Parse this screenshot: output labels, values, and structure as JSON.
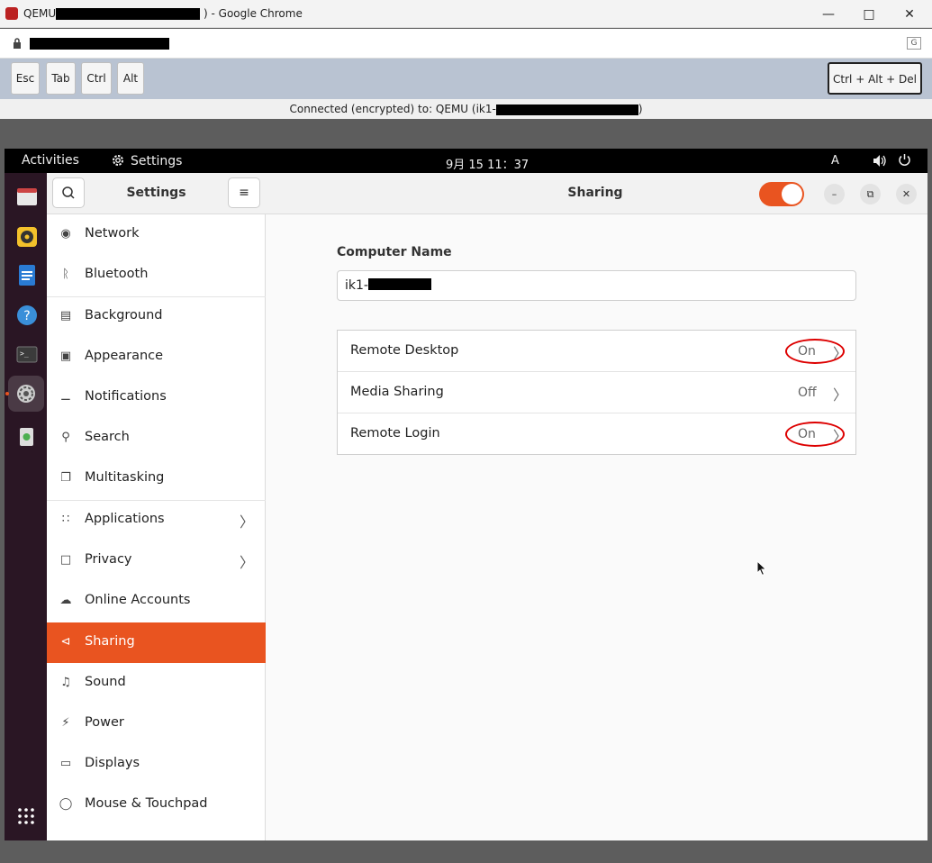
{
  "browser": {
    "title_prefix": "QEMU",
    "title_suffix": ") - Google Chrome",
    "min_icon": "minimize-icon",
    "max_icon": "maximize-icon",
    "close_icon": "close-icon"
  },
  "keys": {
    "esc": "Esc",
    "tab": "Tab",
    "ctrl": "Ctrl",
    "alt": "Alt",
    "cad": "Ctrl + Alt + Del"
  },
  "connection": {
    "prefix": "Connected (encrypted) to: QEMU (ik1-",
    "suffix": ")"
  },
  "topbar": {
    "activities": "Activities",
    "app": "Settings",
    "clock": "9月 15  11：37",
    "ime": "A"
  },
  "sidebar": {
    "title": "Settings",
    "items": [
      {
        "label": "Network"
      },
      {
        "label": "Bluetooth"
      },
      {
        "label": "Background"
      },
      {
        "label": "Appearance"
      },
      {
        "label": "Notifications"
      },
      {
        "label": "Search"
      },
      {
        "label": "Multitasking"
      },
      {
        "label": "Applications"
      },
      {
        "label": "Privacy"
      },
      {
        "label": "Online Accounts"
      },
      {
        "label": "Sharing"
      },
      {
        "label": "Sound"
      },
      {
        "label": "Power"
      },
      {
        "label": "Displays"
      },
      {
        "label": "Mouse & Touchpad"
      }
    ]
  },
  "main": {
    "title": "Sharing",
    "sharing_enabled": true,
    "computer_name_label": "Computer Name",
    "computer_name_value": "ik1-",
    "rows": [
      {
        "label": "Remote Desktop",
        "value": "On"
      },
      {
        "label": "Media Sharing",
        "value": "Off"
      },
      {
        "label": "Remote Login",
        "value": "On"
      }
    ]
  },
  "colors": {
    "accent": "#e95420",
    "annotation": "#dd0000"
  }
}
